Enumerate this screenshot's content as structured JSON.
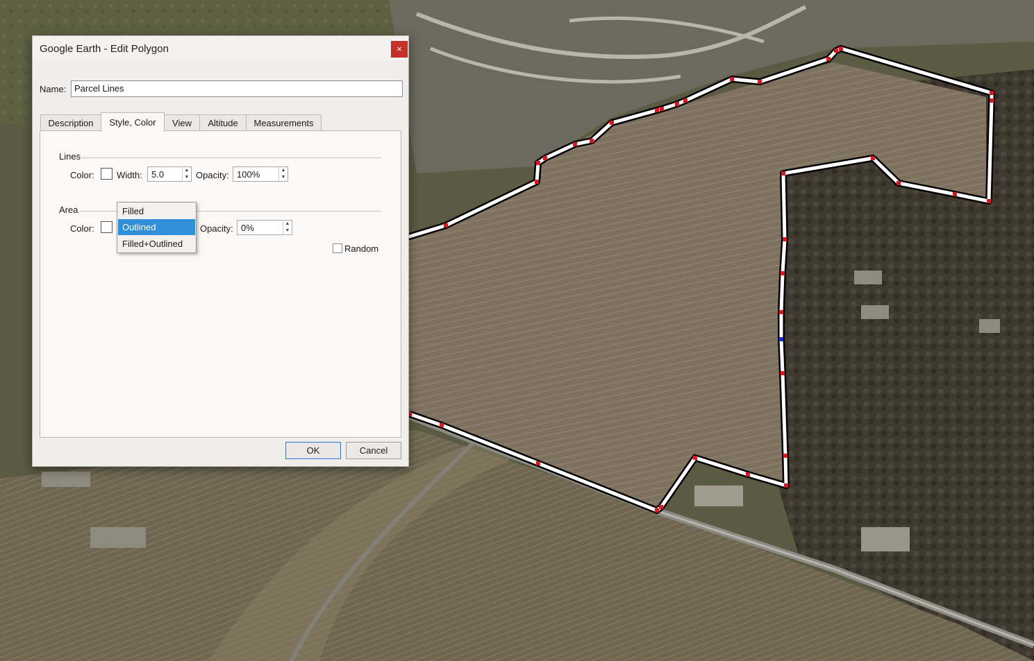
{
  "dialog": {
    "title": "Google Earth - Edit Polygon",
    "close_glyph": "×",
    "name_label": "Name:",
    "name_value": "Parcel Lines",
    "tabs": [
      {
        "label": "Description",
        "active": false
      },
      {
        "label": "Style, Color",
        "active": true
      },
      {
        "label": "View",
        "active": false
      },
      {
        "label": "Altitude",
        "active": false
      },
      {
        "label": "Measurements",
        "active": false
      }
    ],
    "lines": {
      "group_label": "Lines",
      "color_label": "Color:",
      "color": "#ffffff",
      "width_label": "Width:",
      "width_value": "5.0",
      "opacity_label": "Opacity:",
      "opacity_value": "100%"
    },
    "area": {
      "group_label": "Area",
      "color_label": "Color:",
      "color": "#ffffff",
      "opacity_label": "Opacity:",
      "opacity_value": "0%",
      "random_label": "Random",
      "random_checked": false,
      "draw_mode_options": [
        "Filled",
        "Outlined",
        "Filled+Outlined"
      ],
      "draw_mode_selected": "Outlined"
    },
    "ok_label": "OK",
    "cancel_label": "Cancel"
  },
  "colors": {
    "polygon_line": "#ffffff",
    "polygon_outline": "#000000",
    "vertex": "#e0141b",
    "selected_vertex": "#1a2bd6",
    "selection_highlight": "#2f8fd8",
    "close_button": "#c5302a"
  },
  "icons": {
    "close": "close-icon",
    "spin_up": "spin-up-icon",
    "spin_down": "spin-down-icon"
  }
}
